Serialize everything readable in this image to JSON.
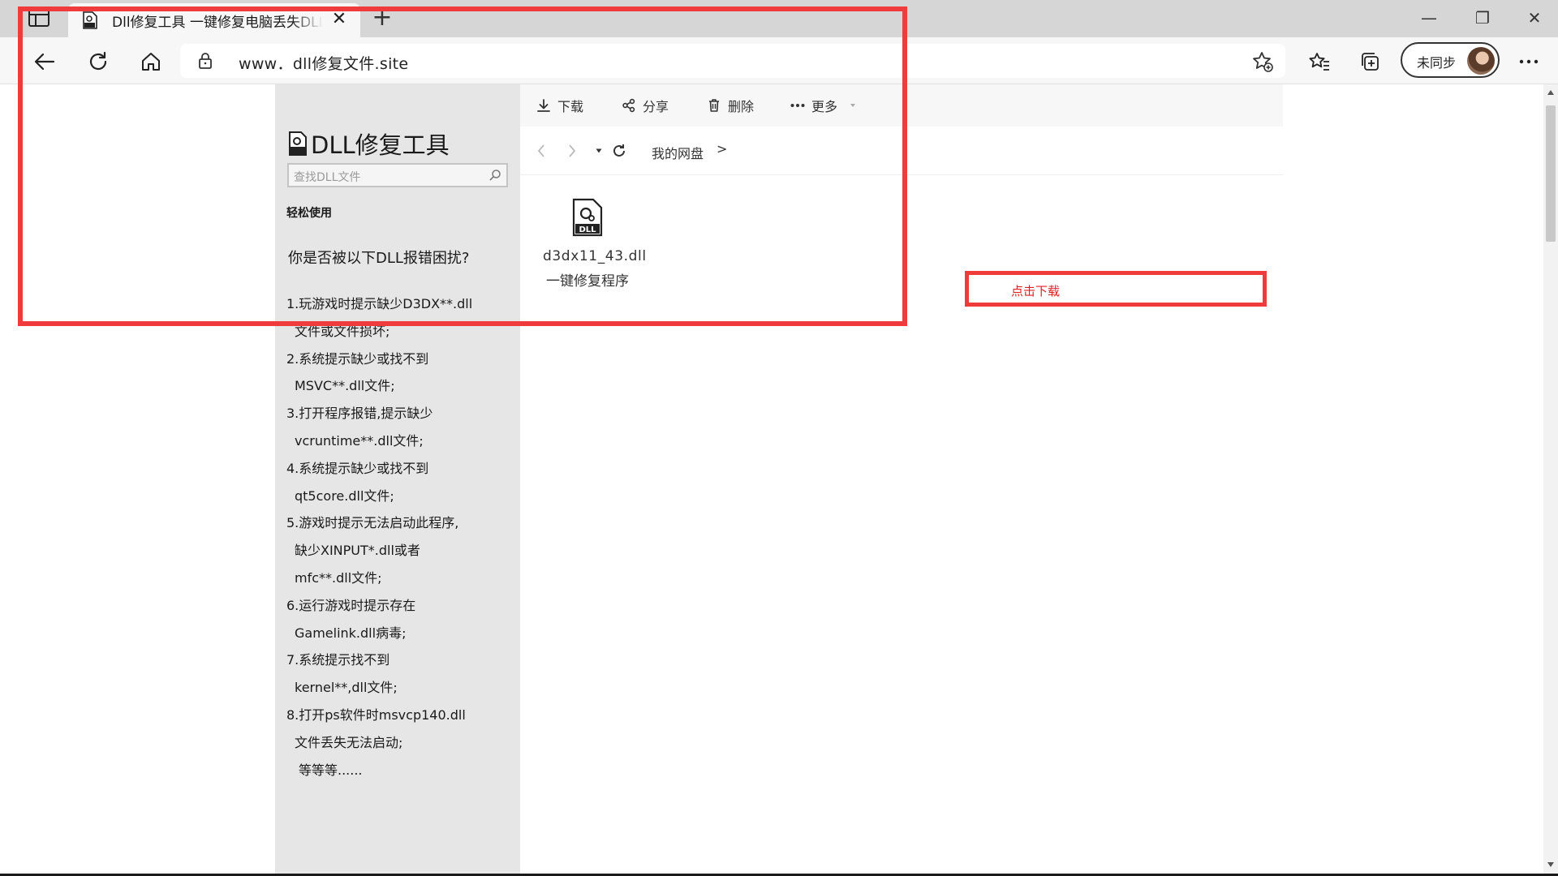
{
  "browser": {
    "tab_title": "Dll修复工具 一键修复电脑丢失DLL文件",
    "url": "www．dll修复文件.site",
    "profile_label": "未同步",
    "close_tab_glyph": "✕",
    "new_tab_glyph": "+",
    "window_controls": {
      "minimize": "—",
      "restore": "❐",
      "close": "✕"
    }
  },
  "sidebar": {
    "brand_title": "DLL修复工具",
    "search_placeholder": "查找DLL文件",
    "easy_use": "轻松使用",
    "question": "你是否被以下DLL报错困扰?",
    "issues": [
      "1.玩游戏时提示缺少D3DX**.dll",
      "文件或文件损坏;",
      "2.系统提示缺少或找不到",
      "MSVC**.dll文件;",
      "3.打开程序报错,提示缺少",
      "vcruntime**.dll文件;",
      "4.系统提示缺少或找不到",
      "qt5core.dll文件;",
      "5.游戏时提示无法启动此程序,",
      "缺少XINPUT*.dll或者",
      "mfc**.dll文件;",
      "6.运行游戏时提示存在",
      "Gamelink.dll病毒;",
      "7.系统提示找不到",
      "kernel**,dll文件;",
      "8.打开ps软件时msvcp140.dll",
      "文件丢失无法启动;",
      "等等等......"
    ]
  },
  "content": {
    "toolbar": {
      "download": "下载",
      "share": "分享",
      "delete": "删除",
      "more": "更多"
    },
    "breadcrumb": "我的网盘",
    "breadcrumb_sep": ">",
    "file": {
      "name": "d3dx11_43.dll",
      "subtitle": "一键修复程序",
      "icon_label": "DLL"
    }
  },
  "overlay": {
    "download_label": "点击下载"
  },
  "colors": {
    "highlight": "#ef3b3b",
    "sidebar_bg": "#e6e6e6",
    "chrome_bg": "#d6d6d6"
  }
}
